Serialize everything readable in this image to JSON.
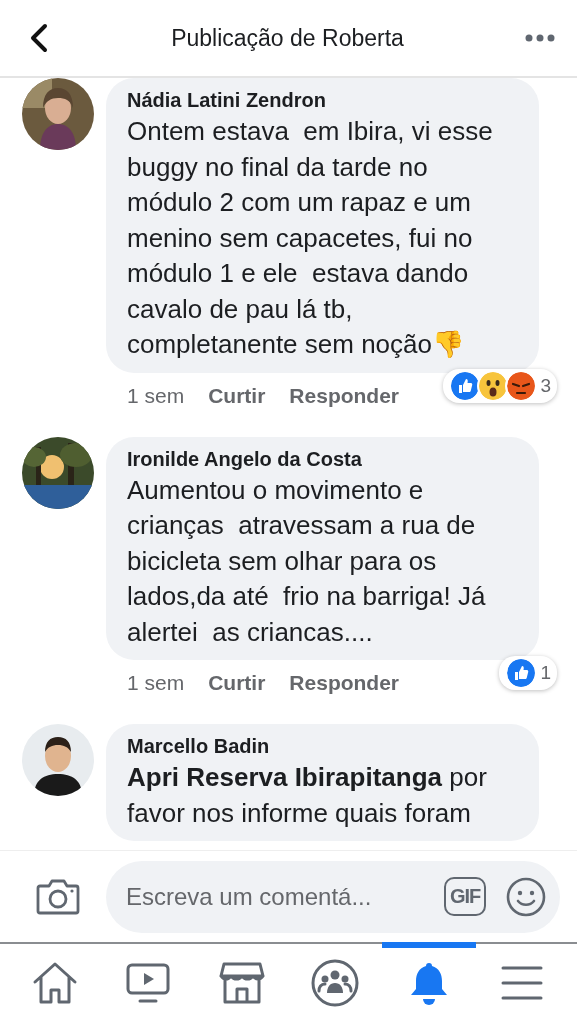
{
  "header": {
    "title": "Publicação de Roberta"
  },
  "comments": [
    {
      "author": "Nádia Latini Zendron",
      "text": "Ontem estava  em Ibira, vi esse buggy no final da tarde no módulo 2 com um rapaz e um menino sem capacetes, fui no módulo 1 e ele  estava dando cavalo de pau lá tb, completanente sem noção👎",
      "time": "1 sem",
      "like": "Curtir",
      "reply": "Responder",
      "reactions": [
        {
          "kind": "like"
        },
        {
          "kind": "wow"
        },
        {
          "kind": "angry"
        }
      ],
      "reaction_count": "3"
    },
    {
      "author": "Ironilde Angelo da Costa",
      "text": "Aumentou o movimento e crianças  atravessam a rua de bicicleta sem olhar para os lados,da até  frio na barriga! Já  alertei  as criancas....",
      "time": "1 sem",
      "like": "Curtir",
      "reply": "Responder",
      "reactions": [
        {
          "kind": "like"
        }
      ],
      "reaction_count": "1"
    },
    {
      "author": "Marcello Badin",
      "text": "**Apri Reserva Ibirapitanga** por favor nos informe quais foram"
    }
  ],
  "composer": {
    "placeholder": "Escreva um comentá...",
    "gif": "GIF"
  },
  "tabs": [
    {
      "kind": "home",
      "selected": false
    },
    {
      "kind": "video",
      "selected": false
    },
    {
      "kind": "marketplace",
      "selected": false
    },
    {
      "kind": "groups",
      "selected": false
    },
    {
      "kind": "notifications",
      "selected": true
    },
    {
      "kind": "menu",
      "selected": false
    }
  ]
}
